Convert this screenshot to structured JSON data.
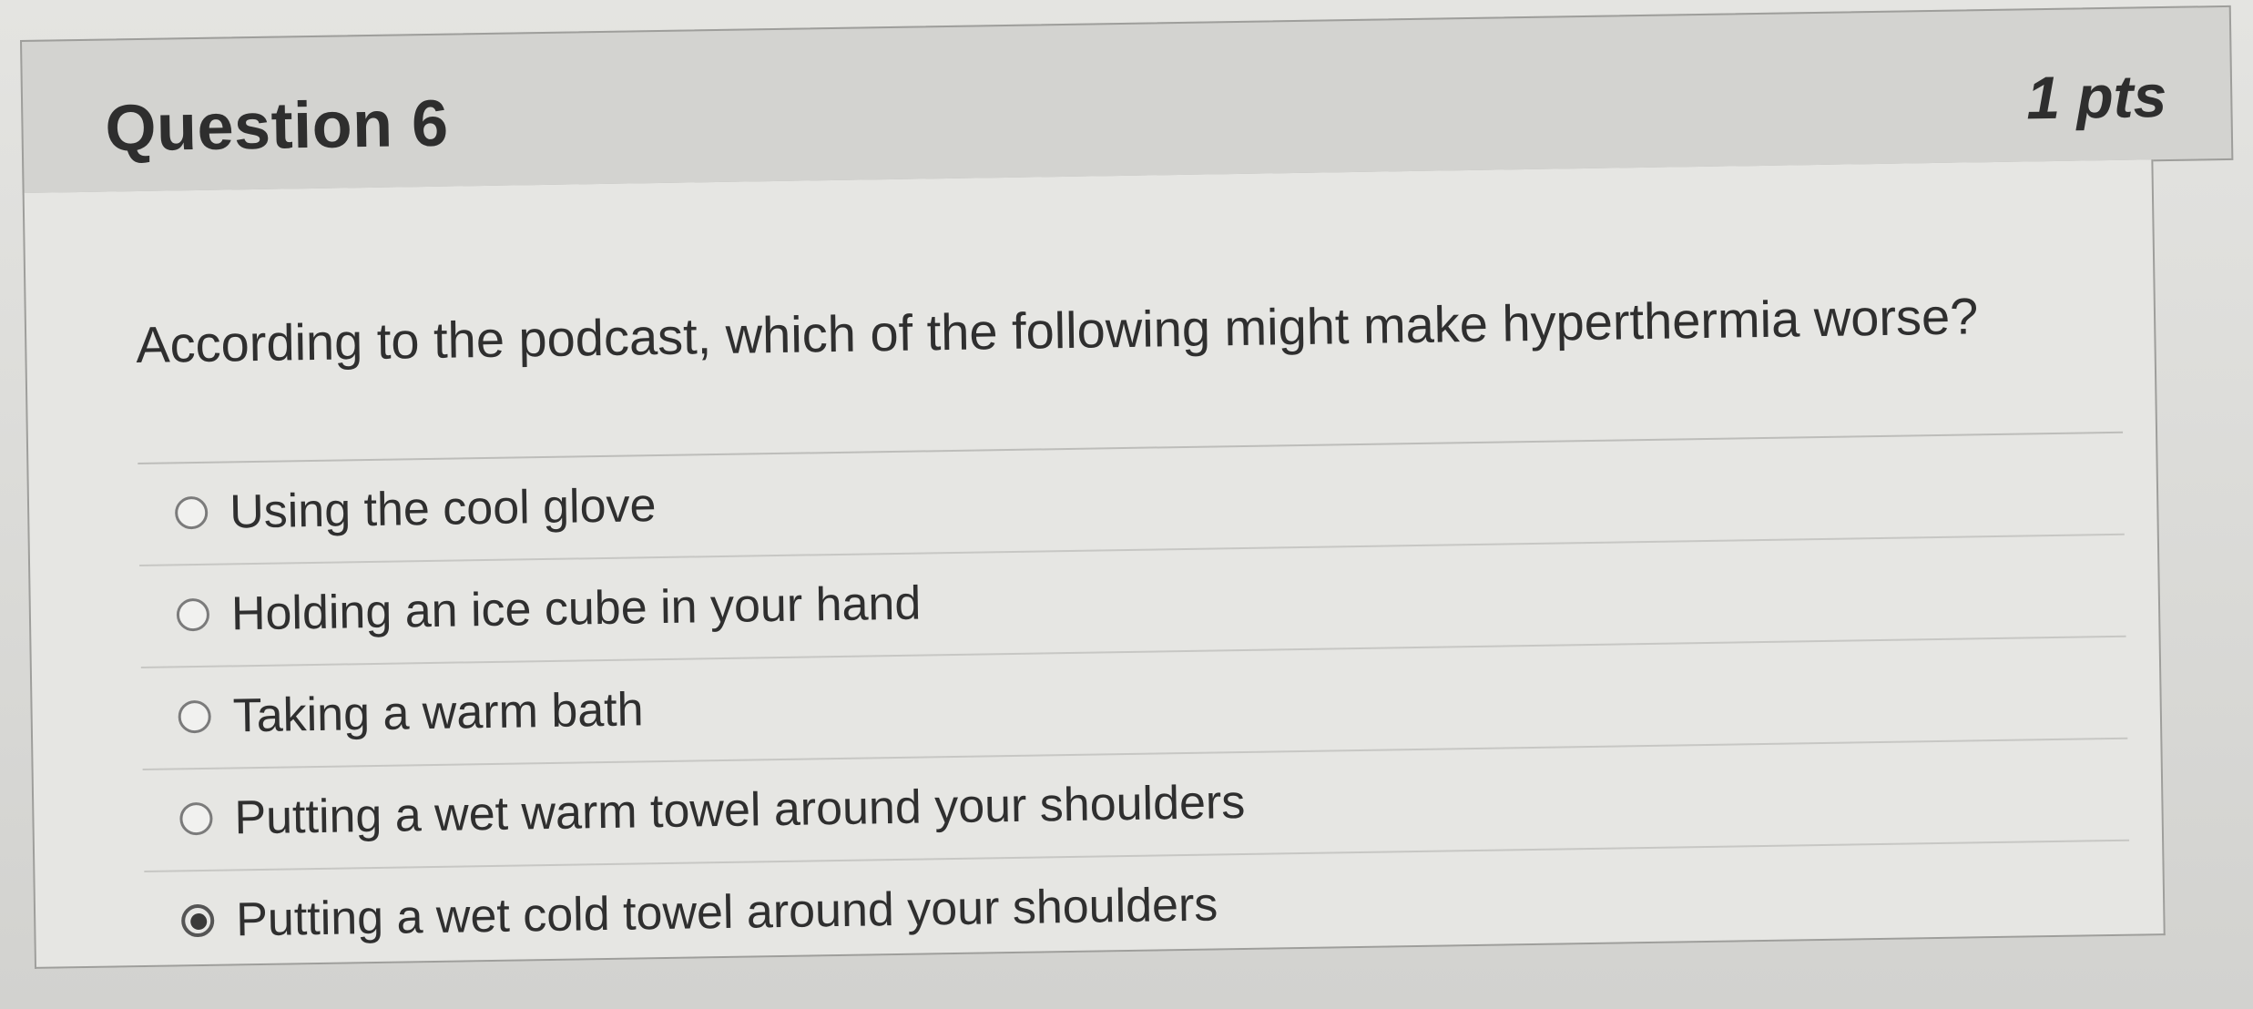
{
  "question": {
    "title": "Question 6",
    "points": "1 pts",
    "prompt": "According to the podcast, which of the following might make hyperthermia worse?"
  },
  "answers": [
    {
      "label": "Using the cool glove",
      "selected": false
    },
    {
      "label": "Holding an ice cube in your hand",
      "selected": false
    },
    {
      "label": "Taking a warm bath",
      "selected": false
    },
    {
      "label": "Putting a wet warm towel around your shoulders",
      "selected": false
    },
    {
      "label": "Putting a wet cold towel around your shoulders",
      "selected": true
    }
  ]
}
